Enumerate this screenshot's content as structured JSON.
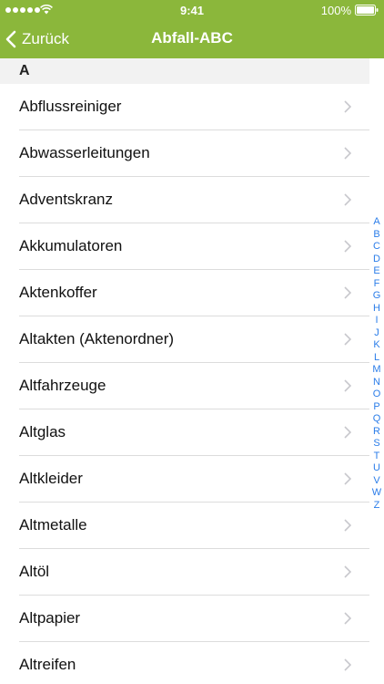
{
  "status_bar": {
    "time": "9:41",
    "battery": "100%"
  },
  "nav": {
    "back_label": "Zurück",
    "title": "Abfall-ABC"
  },
  "section": {
    "letter": "A"
  },
  "items": [
    "Abflussreiniger",
    "Abwasserleitungen",
    "Adventskranz",
    "Akkumulatoren",
    "Aktenkoffer",
    "Altakten (Aktenordner)",
    "Altfahrzeuge",
    "Altglas",
    "Altkleider",
    "Altmetalle",
    "Altöl",
    "Altpapier",
    "Altreifen"
  ],
  "index": [
    "A",
    "B",
    "C",
    "D",
    "E",
    "F",
    "G",
    "H",
    "I",
    "J",
    "K",
    "L",
    "M",
    "N",
    "O",
    "P",
    "Q",
    "R",
    "S",
    "T",
    "U",
    "V",
    "W",
    "Z"
  ],
  "colors": {
    "header_green": "#8bb73b",
    "index_blue": "#2b7de9",
    "chevron_gray": "#c7c7cc"
  },
  "icons": {
    "back": "chevron-left-icon",
    "row": "chevron-right-icon",
    "wifi": "wifi-icon",
    "battery": "battery-icon"
  }
}
